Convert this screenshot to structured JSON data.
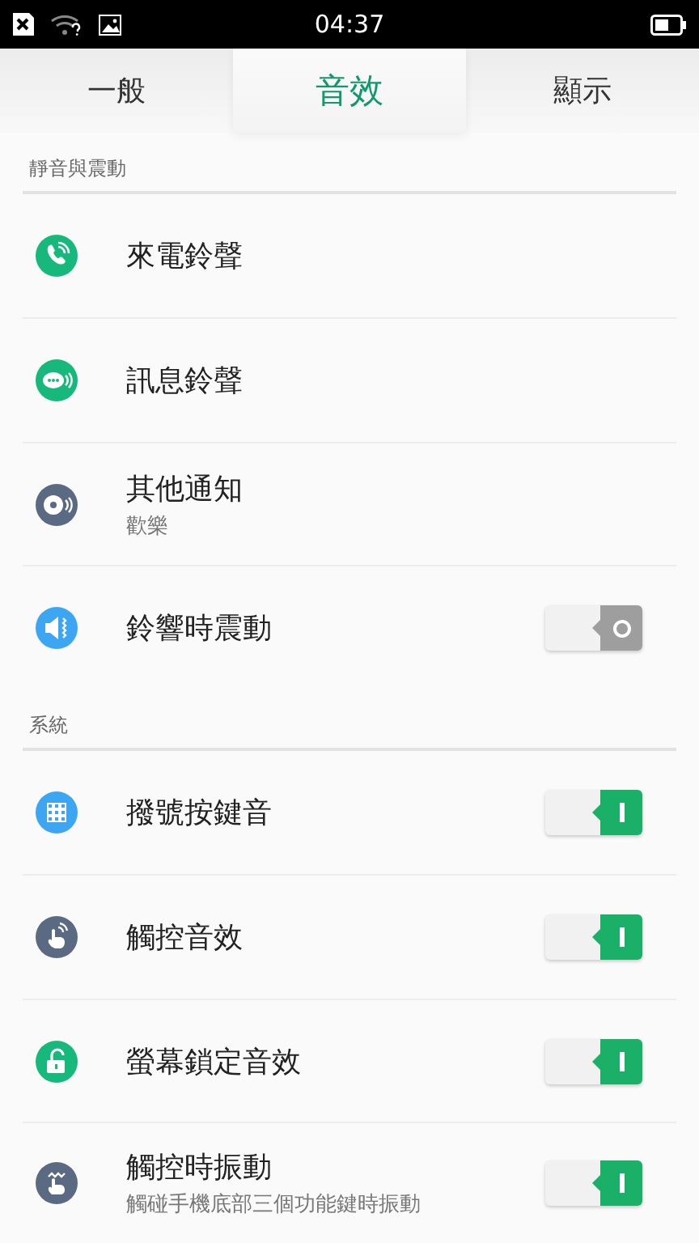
{
  "status_bar": {
    "time": "04:37"
  },
  "tabs": [
    {
      "label": "一般",
      "selected": false
    },
    {
      "label": "音效",
      "selected": true
    },
    {
      "label": "顯示",
      "selected": false
    }
  ],
  "sections": [
    {
      "title": "靜音與震動",
      "items": [
        {
          "kind": "link",
          "label": "來電鈴聲"
        },
        {
          "kind": "link",
          "label": "訊息鈴聲"
        },
        {
          "kind": "link",
          "label": "其他通知",
          "subtitle": "歡樂"
        },
        {
          "kind": "toggle",
          "label": "鈴響時震動",
          "on": false
        }
      ]
    },
    {
      "title": "系統",
      "items": [
        {
          "kind": "toggle",
          "label": "撥號按鍵音",
          "on": true
        },
        {
          "kind": "toggle",
          "label": "觸控音效",
          "on": true
        },
        {
          "kind": "toggle",
          "label": "螢幕鎖定音效",
          "on": true
        },
        {
          "kind": "toggle",
          "label": "觸控時振動",
          "subtitle": "觸碰手機底部三個功能鍵時振動",
          "on": true
        }
      ]
    }
  ]
}
